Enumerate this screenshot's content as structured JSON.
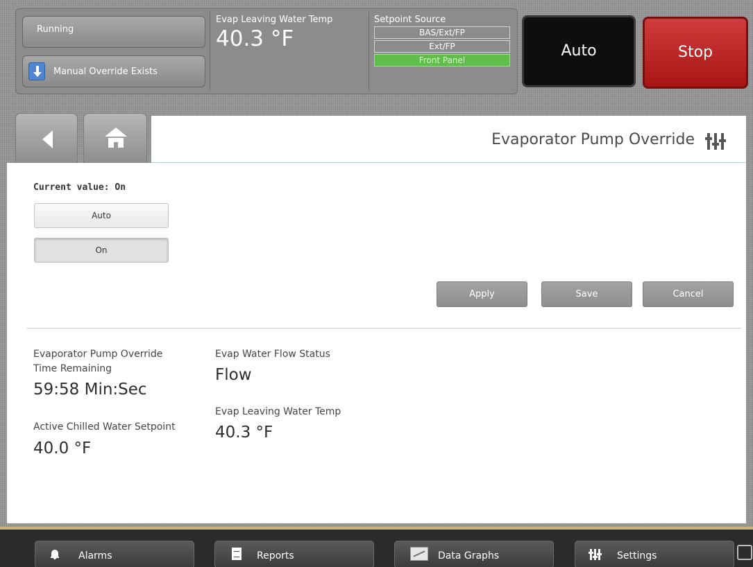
{
  "header": {
    "status": "Running",
    "override": "Manual Override Exists",
    "evap_label": "Evap Leaving Water Temp",
    "evap_value": "40.3 °F",
    "setpoint_label": "Setpoint Source",
    "setpoint_options": [
      "BAS/Ext/FP",
      "Ext/FP",
      "Front Panel"
    ],
    "setpoint_active": "Front Panel",
    "auto_label": "Auto",
    "stop_label": "Stop"
  },
  "page": {
    "title": "Evaporator Pump Override",
    "current_value": "Current value: On",
    "options": [
      "Auto",
      "On"
    ],
    "selected_option": "On",
    "actions": {
      "apply": "Apply",
      "save": "Save",
      "cancel": "Cancel"
    }
  },
  "info": {
    "time_remaining_label_1": "Evaporator Pump Override",
    "time_remaining_label_2": "Time Remaining",
    "time_remaining_value": "59:58 Min:Sec",
    "active_setpoint_label": "Active Chilled Water Setpoint",
    "active_setpoint_value": "40.0 °F",
    "flow_label": "Evap Water Flow Status",
    "flow_value": "Flow",
    "evap_temp_label": "Evap Leaving Water Temp",
    "evap_temp_value": "40.3 °F"
  },
  "nav": {
    "alarms": "Alarms",
    "reports": "Reports",
    "graphs": "Data Graphs",
    "settings": "Settings"
  },
  "icons": [
    "download-icon",
    "back-arrow-icon",
    "home-icon",
    "settings-sliders-icon",
    "bell-icon",
    "document-icon",
    "graph-icon",
    "chat-icon"
  ],
  "colors": {
    "active_source": "#5fbe4a",
    "stop": "#c02424",
    "auto": "#0e0e0e"
  }
}
